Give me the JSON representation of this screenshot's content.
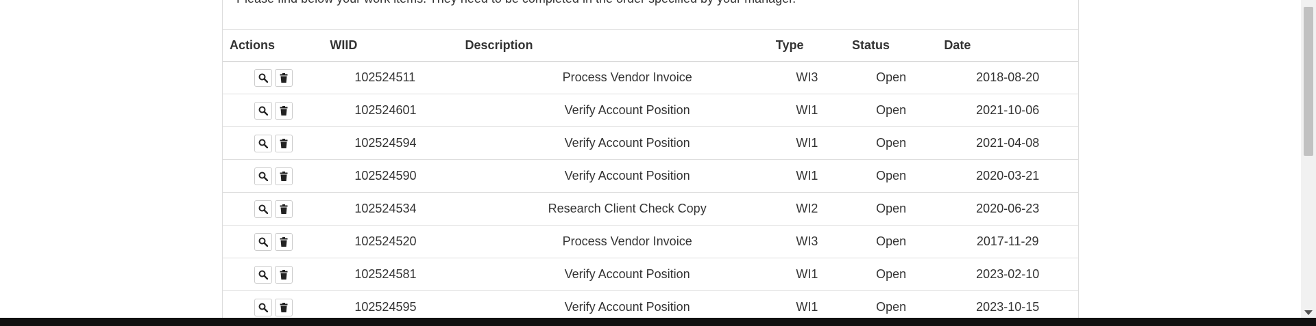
{
  "intro_text": "Please find below your work items. They need to be completed in the order specified by your manager.",
  "table": {
    "headers": {
      "actions": "Actions",
      "wiid": "WIID",
      "description": "Description",
      "type": "Type",
      "status": "Status",
      "date": "Date"
    },
    "rows": [
      {
        "wiid": "102524511",
        "description": "Process Vendor Invoice",
        "type": "WI3",
        "status": "Open",
        "date": "2018-08-20"
      },
      {
        "wiid": "102524601",
        "description": "Verify Account Position",
        "type": "WI1",
        "status": "Open",
        "date": "2021-10-06"
      },
      {
        "wiid": "102524594",
        "description": "Verify Account Position",
        "type": "WI1",
        "status": "Open",
        "date": "2021-04-08"
      },
      {
        "wiid": "102524590",
        "description": "Verify Account Position",
        "type": "WI1",
        "status": "Open",
        "date": "2020-03-21"
      },
      {
        "wiid": "102524534",
        "description": "Research Client Check Copy",
        "type": "WI2",
        "status": "Open",
        "date": "2020-06-23"
      },
      {
        "wiid": "102524520",
        "description": "Process Vendor Invoice",
        "type": "WI3",
        "status": "Open",
        "date": "2017-11-29"
      },
      {
        "wiid": "102524581",
        "description": "Verify Account Position",
        "type": "WI1",
        "status": "Open",
        "date": "2023-02-10"
      },
      {
        "wiid": "102524595",
        "description": "Verify Account Position",
        "type": "WI1",
        "status": "Open",
        "date": "2023-10-15"
      }
    ]
  },
  "icons": {
    "view": "search-icon",
    "delete": "trash-icon"
  }
}
